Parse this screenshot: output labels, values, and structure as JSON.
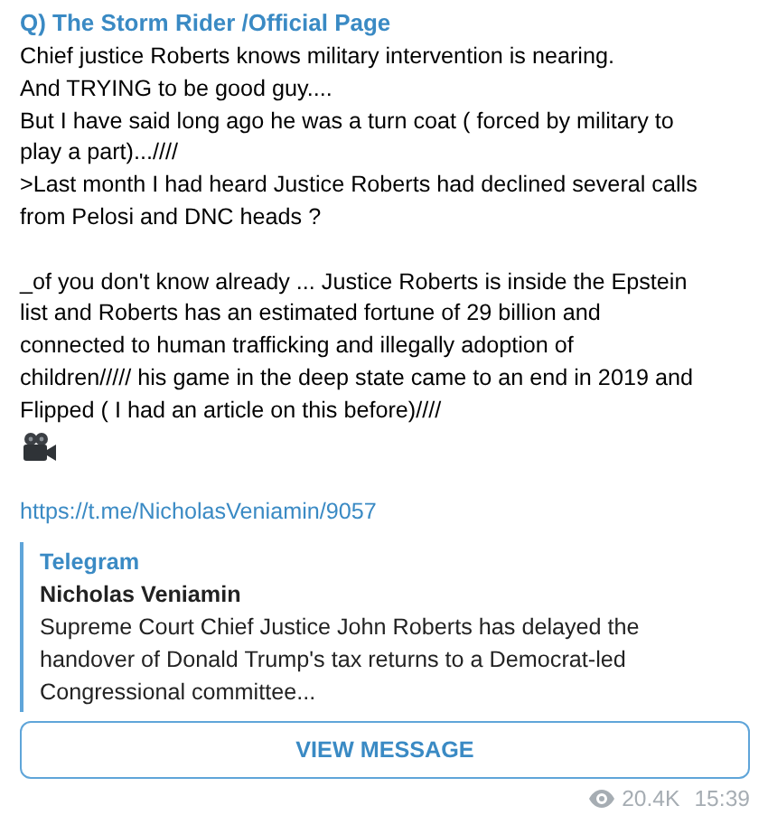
{
  "message": {
    "author": "Q) The Storm Rider /Official Page",
    "paragraphs": [
      "Chief justice Roberts knows military intervention is nearing.\nAnd TRYING to be good guy....\nBut I have said long ago he was a turn coat ( forced by military to\nplay a part)...////\n>Last month I had heard Justice Roberts had declined several calls\nfrom Pelosi and DNC heads ?",
      "_of you don't know already ... Justice Roberts is inside the Epstein\nlist and Roberts has an estimated fortune of 29 billion and\nconnected to human trafficking and illegally adoption of\nchildren///// his game in the deep state came to an end in 2019 and\nFlipped ( I had an article on this before)////"
    ],
    "link": "https://t.me/NicholasVeniamin/9057",
    "preview": {
      "site": "Telegram",
      "title": "Nicholas Veniamin",
      "description": "Supreme Court Chief Justice John Roberts has delayed the\nhandover of Donald Trump's tax returns to a Democrat-led\nCongressional committee..."
    },
    "button": "VIEW MESSAGE",
    "views": "20.4K",
    "time": "15:39"
  }
}
